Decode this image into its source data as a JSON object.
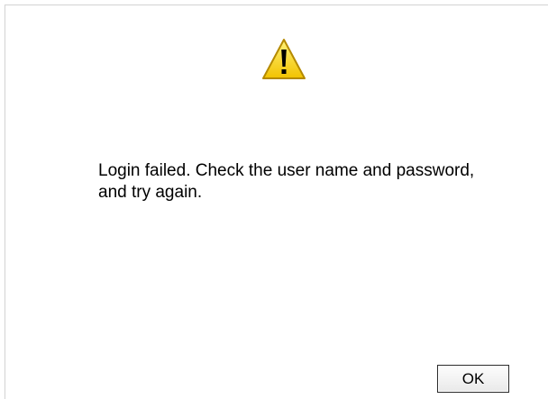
{
  "dialog": {
    "icon": "warning-icon",
    "message": "Login failed. Check the user name and password, and try again.",
    "ok_label": "OK"
  },
  "colors": {
    "warning_fill": "#f7d51c",
    "warning_stroke": "#b58a00",
    "button_border": "#2b2b2b"
  }
}
